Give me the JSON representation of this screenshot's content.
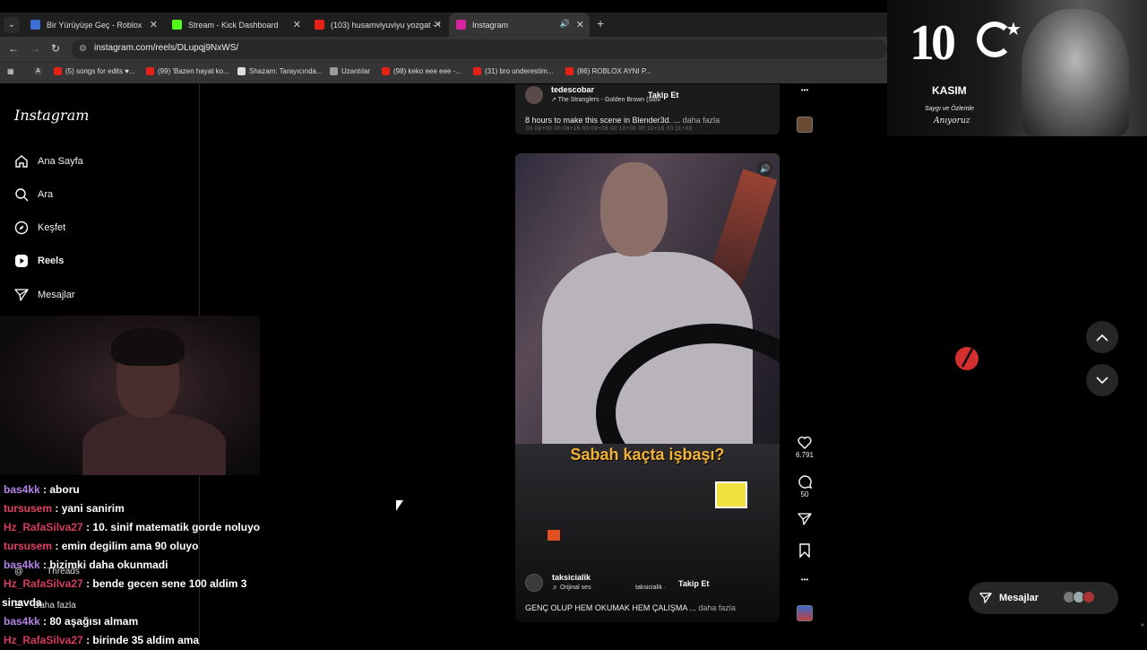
{
  "browser": {
    "tabs": [
      {
        "title": "Bir Yürüyüşe Geç - Roblox",
        "color": "#3b6fd4"
      },
      {
        "title": "Stream - Kick Dashboard",
        "color": "#53fc18"
      },
      {
        "title": "(103) husamviyuviyu yozgat - Y",
        "color": "#e62117"
      },
      {
        "title": "Instagram",
        "color": "#d6249f"
      }
    ],
    "url": "instagram.com/reels/DLupqj9NxWS/",
    "bookmarks": [
      "(5) songs for edits ♥...",
      "(99) 'Bazen hayat ko...",
      "Shazam: Tarayıcında...",
      "Uzantılar",
      "(98) keko eee eee -...",
      "(31) bro underestim...",
      "(86) ROBLOX AYNI P..."
    ]
  },
  "sidebar": {
    "logo": "Instagram",
    "items": [
      {
        "label": "Ana Sayfa",
        "icon": "home-icon"
      },
      {
        "label": "Ara",
        "icon": "search-icon"
      },
      {
        "label": "Keşfet",
        "icon": "compass-icon"
      },
      {
        "label": "Reels",
        "icon": "reels-icon"
      },
      {
        "label": "Mesajlar",
        "icon": "send-icon"
      }
    ],
    "threads": "Threads",
    "more": "Daha fazla"
  },
  "chat": [
    {
      "user": "bas4kk",
      "msg": ": aboru",
      "cls": "u1"
    },
    {
      "user": "tursusem",
      "msg": ": yani sanirim",
      "cls": "u2"
    },
    {
      "user": "Hz_RafaSilva27",
      "msg": ": 10. sinif matematik gorde noluyo",
      "cls": "u3"
    },
    {
      "user": "tursusem",
      "msg": ": emin degilim ama 90 oluyo",
      "cls": "u2"
    },
    {
      "user": "bas4kk",
      "msg": ": bizimki daha okunmadi",
      "cls": "u1"
    },
    {
      "user": "Hz_RafaSilva27",
      "msg": ": bende gecen sene 100 aldim 3",
      "cls": "u3"
    },
    {
      "user": "",
      "msg": "sinavda",
      "cls": ""
    },
    {
      "user": "bas4kk",
      "msg": ": 80 aşağısı almam",
      "cls": "u1"
    },
    {
      "user": "Hz_RafaSilva27",
      "msg": ": birinde 35 aldim ama",
      "cls": "u3"
    }
  ],
  "prev_reel": {
    "user": "tedescobar",
    "song": "↗ The Stranglers - Golden Brown (Slov",
    "follow": "Takip Et",
    "caption": "8 hours to make this scene in Blender3d. ...",
    "more": "daha fazla",
    "timeline": "00:08+00      00:08+16      00:09+08      00:10+00      00:10+16      00:11+08"
  },
  "reel": {
    "overlay_text": "Sabah kaçta işbaşı?",
    "user": "taksicialik",
    "audio": "♬ Orijinal ses",
    "audio_user": "taksicialik ·",
    "follow": "Takip Et",
    "caption": "GENÇ OLUP HEM OKUMAK HEM ÇALIŞMA ...",
    "more": "daha fazla",
    "likes": "6.791",
    "comments": "50"
  },
  "banner": {
    "num": "10",
    "kasim": "KASIM",
    "saygi": "Saygı ve Özlemle",
    "aniyoruz": "Anıyoruz"
  },
  "messages_button": "Mesajlar"
}
